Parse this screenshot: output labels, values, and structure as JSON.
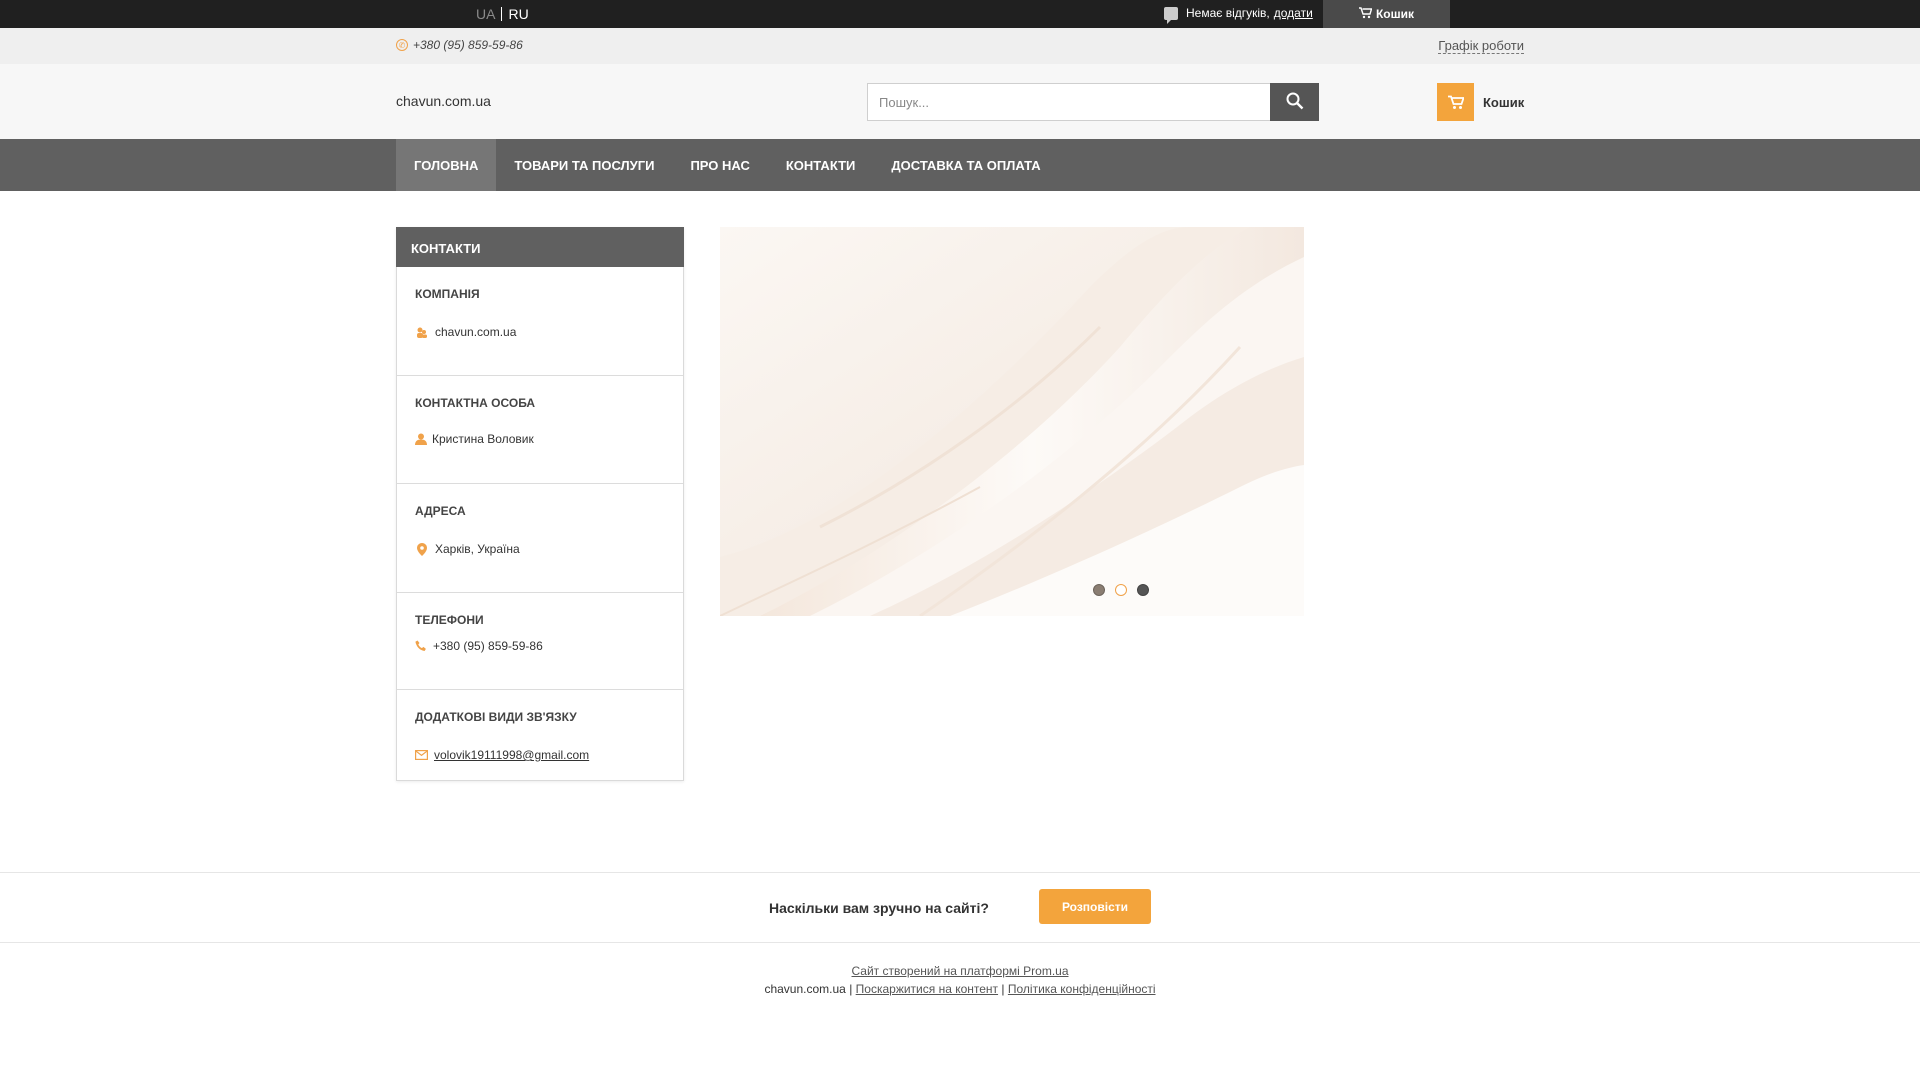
{
  "topbar": {
    "lang_ua": "UA",
    "lang_ru": "RU",
    "reviews_text": "Немає відгуків,",
    "reviews_link": "додати",
    "cart_label": "Кошик"
  },
  "infobar": {
    "phone": "+380 (95) 859-59-86",
    "schedule": "Графік роботи"
  },
  "header": {
    "site_name": "chavun.com.ua",
    "search_placeholder": "Пошук...",
    "cart_label": "Кошик"
  },
  "nav": {
    "items": [
      {
        "label": "ГОЛОВНА"
      },
      {
        "label": "ТОВАРИ ТА ПОСЛУГИ"
      },
      {
        "label": "ПРО НАС"
      },
      {
        "label": "КОНТАКТИ"
      },
      {
        "label": "ДОСТАВКА ТА ОПЛАТА"
      }
    ]
  },
  "contacts": {
    "title": "КОНТАКТИ",
    "company_title": "КОМПАНІЯ",
    "company": "chavun.com.ua",
    "person_title": "КОНТАКТНА ОСОБА",
    "person": "Кристина Воловик",
    "address_title": "АДРЕСА",
    "address": "Харків, Україна",
    "phones_title": "ТЕЛЕФОНИ",
    "phone": "+380 (95) 859-59-86",
    "extra_title": "ДОДАТКОВІ ВИДИ ЗВ'ЯЗКУ",
    "email": "volovik19111998@gmail.com"
  },
  "slider": {
    "slide_count": 3,
    "active_index": 0
  },
  "feedback": {
    "question": "Наскільки вам зручно на сайті?",
    "button": "Розповісти"
  },
  "footer": {
    "platform_link": "Сайт створений на платформі Prom.ua",
    "site": "chavun.com.ua",
    "separator": "|",
    "complain_link": "Поскаржитися на контент",
    "privacy_link": "Політика конфіденційності"
  },
  "colors": {
    "accent": "#f3a43c",
    "nav_bg": "#606060",
    "topbar_bg": "#202020"
  }
}
